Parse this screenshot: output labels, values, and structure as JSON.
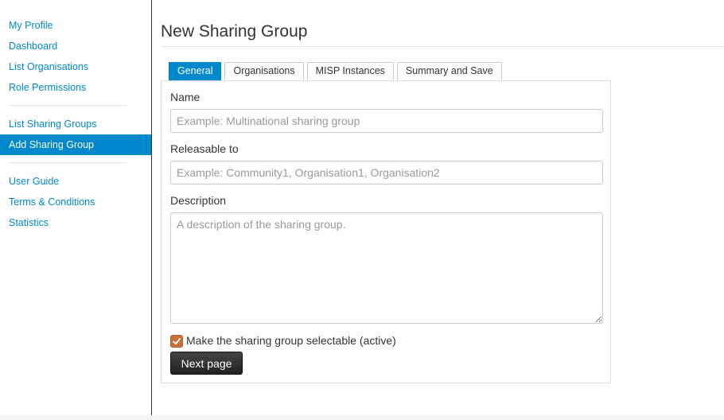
{
  "sidebar": {
    "group1": [
      {
        "label": "My Profile"
      },
      {
        "label": "Dashboard"
      },
      {
        "label": "List Organisations"
      },
      {
        "label": "Role Permissions"
      }
    ],
    "group2": [
      {
        "label": "List Sharing Groups"
      },
      {
        "label": "Add Sharing Group",
        "active": true
      }
    ],
    "group3": [
      {
        "label": "User Guide"
      },
      {
        "label": "Terms & Conditions"
      },
      {
        "label": "Statistics"
      }
    ]
  },
  "page": {
    "title": "New Sharing Group"
  },
  "tabs": [
    {
      "label": "General",
      "active": true
    },
    {
      "label": "Organisations"
    },
    {
      "label": "MISP Instances"
    },
    {
      "label": "Summary and Save"
    }
  ],
  "form": {
    "name_label": "Name",
    "name_placeholder": "Example: Multinational sharing group",
    "name_value": "",
    "releasable_label": "Releasable to",
    "releasable_placeholder": "Example: Community1, Organisation1, Organisation2",
    "releasable_value": "",
    "description_label": "Description",
    "description_placeholder": "A description of the sharing group.",
    "description_value": "",
    "active_checked": true,
    "active_label": "Make the sharing group selectable (active)",
    "next_label": "Next page"
  },
  "colors": {
    "accent": "#0088cc",
    "checkbox": "#c8703a",
    "button_dark": "#222222"
  }
}
